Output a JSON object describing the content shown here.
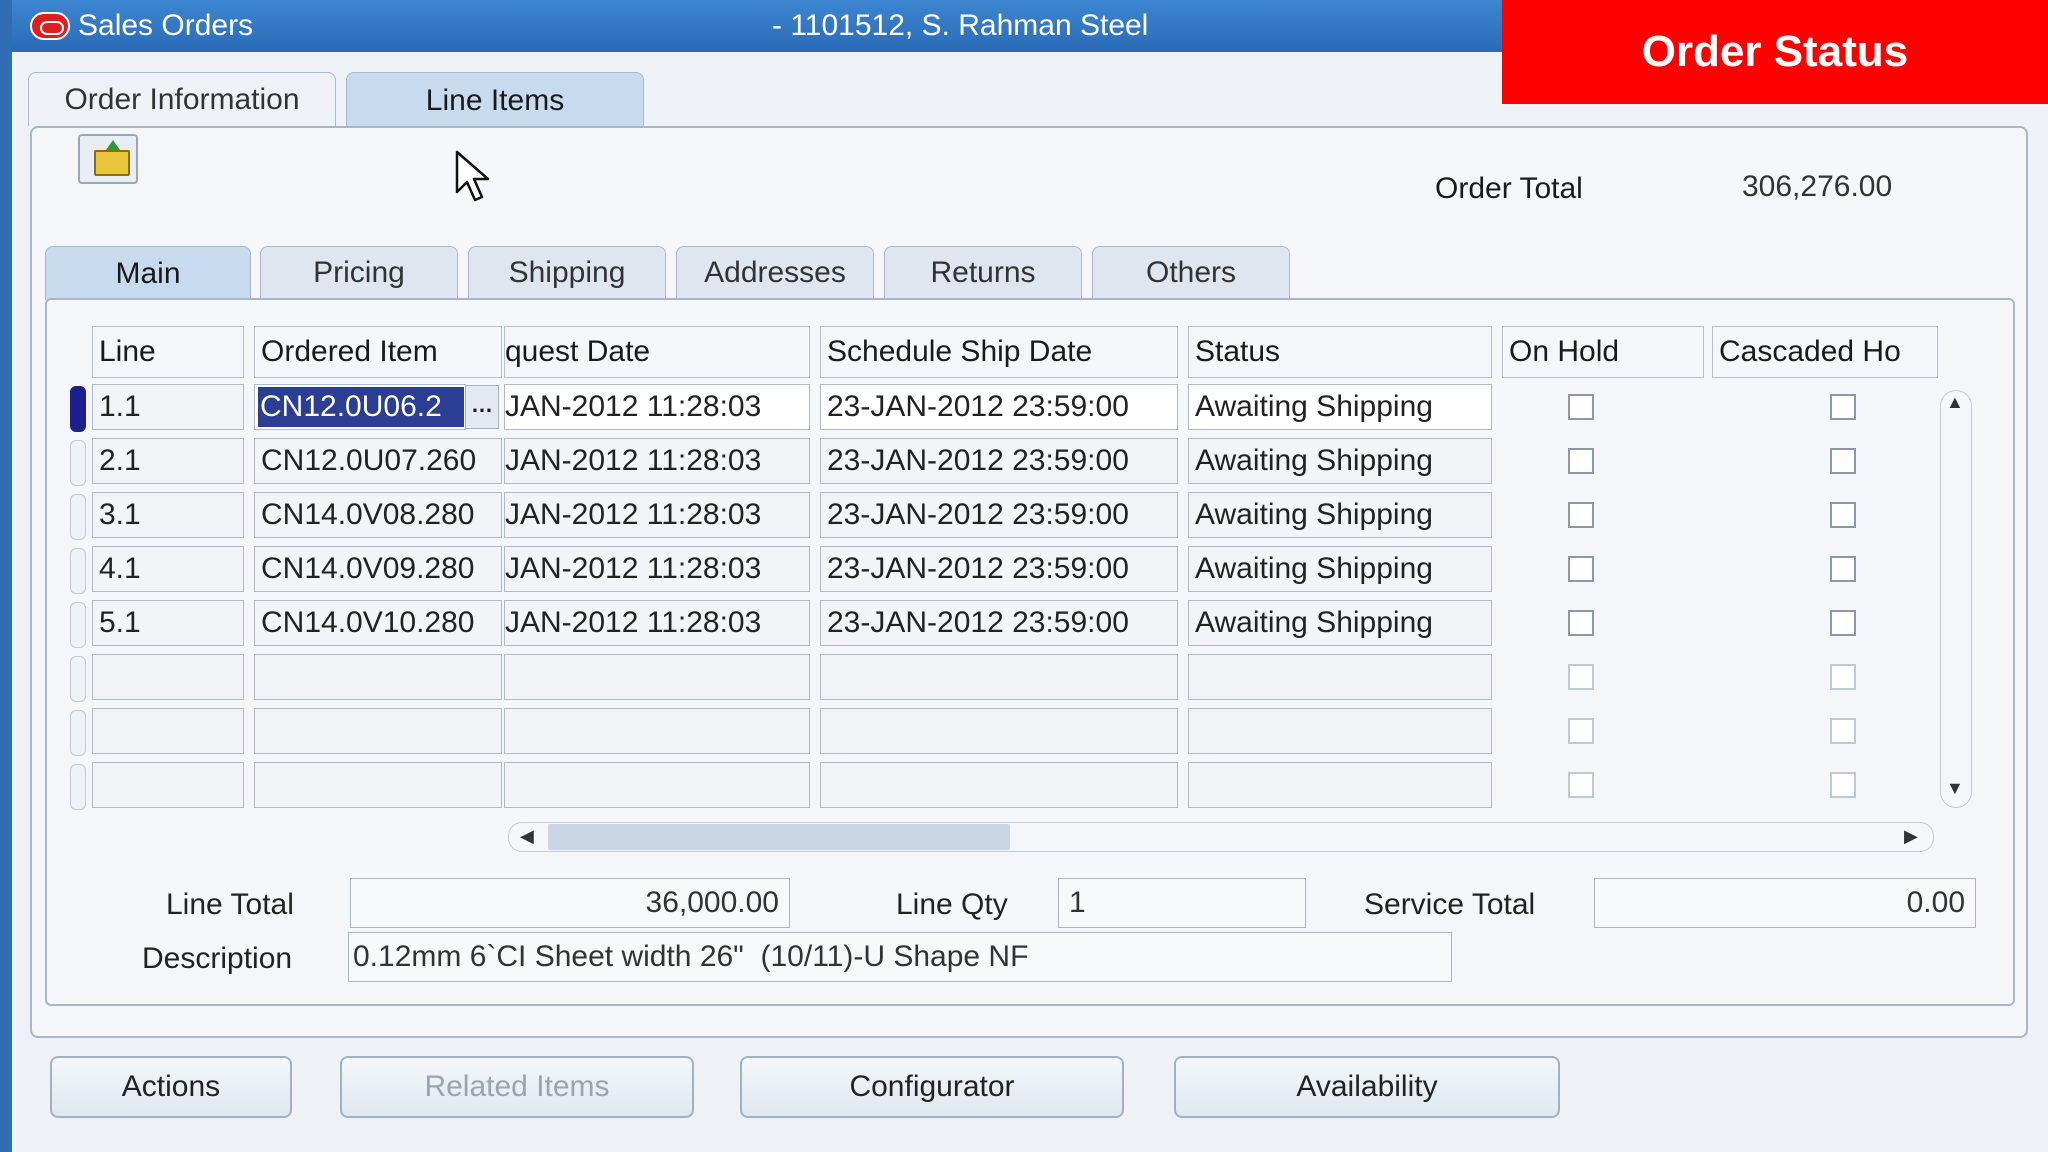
{
  "window": {
    "app_title": "Sales Orders",
    "order_title": "- 1101512, S. Rahman Steel"
  },
  "banner": {
    "text": "Order Status"
  },
  "outer_tabs": [
    {
      "label": "Order Information",
      "active": false
    },
    {
      "label": "Line Items",
      "active": true
    }
  ],
  "order_total": {
    "label": "Order Total",
    "value": "306,276.00"
  },
  "inner_tabs": [
    {
      "label": "Main",
      "active": true
    },
    {
      "label": "Pricing",
      "active": false
    },
    {
      "label": "Shipping",
      "active": false
    },
    {
      "label": "Addresses",
      "active": false
    },
    {
      "label": "Returns",
      "active": false
    },
    {
      "label": "Others",
      "active": false
    }
  ],
  "table": {
    "headers": {
      "line": "Line",
      "ordered_item": "Ordered Item",
      "request_date": "quest Date",
      "schedule_ship_date": "Schedule Ship Date",
      "status": "Status",
      "on_hold": "On Hold",
      "cascaded_hold": "Cascaded Ho"
    },
    "rows": [
      {
        "line": "1.1",
        "item": "CN12.0U06.2",
        "request_date": "JAN-2012 11:28:03",
        "ship_date": "23-JAN-2012 23:59:00",
        "status": "Awaiting Shipping"
      },
      {
        "line": "2.1",
        "item": "CN12.0U07.260",
        "request_date": "JAN-2012 11:28:03",
        "ship_date": "23-JAN-2012 23:59:00",
        "status": "Awaiting Shipping"
      },
      {
        "line": "3.1",
        "item": "CN14.0V08.280",
        "request_date": "JAN-2012 11:28:03",
        "ship_date": "23-JAN-2012 23:59:00",
        "status": "Awaiting Shipping"
      },
      {
        "line": "4.1",
        "item": "CN14.0V09.280",
        "request_date": "JAN-2012 11:28:03",
        "ship_date": "23-JAN-2012 23:59:00",
        "status": "Awaiting Shipping"
      },
      {
        "line": "5.1",
        "item": "CN14.0V10.280",
        "request_date": "JAN-2012 11:28:03",
        "ship_date": "23-JAN-2012 23:59:00",
        "status": "Awaiting Shipping"
      }
    ],
    "lov_button": "…"
  },
  "footer": {
    "line_total_label": "Line Total",
    "line_total_value": "36,000.00",
    "line_qty_label": "Line Qty",
    "line_qty_value": "1",
    "service_total_label": "Service Total",
    "service_total_value": "0.00",
    "description_label": "Description",
    "description_value": "0.12mm 6`CI Sheet width 26\"  (10/11)-U Shape NF"
  },
  "buttons": {
    "actions": "Actions",
    "related_items": "Related Items",
    "configurator": "Configurator",
    "availability": "Availability"
  },
  "icons": {
    "app": "oracle-logo-icon",
    "open": "open-folder-icon",
    "cursor": "mouse-pointer-icon"
  },
  "colors": {
    "titlebar": "#2a6ab6",
    "banner": "#ff0000",
    "selected_text": "#2c3e94",
    "current_row_indicator": "#1d1f8c"
  }
}
